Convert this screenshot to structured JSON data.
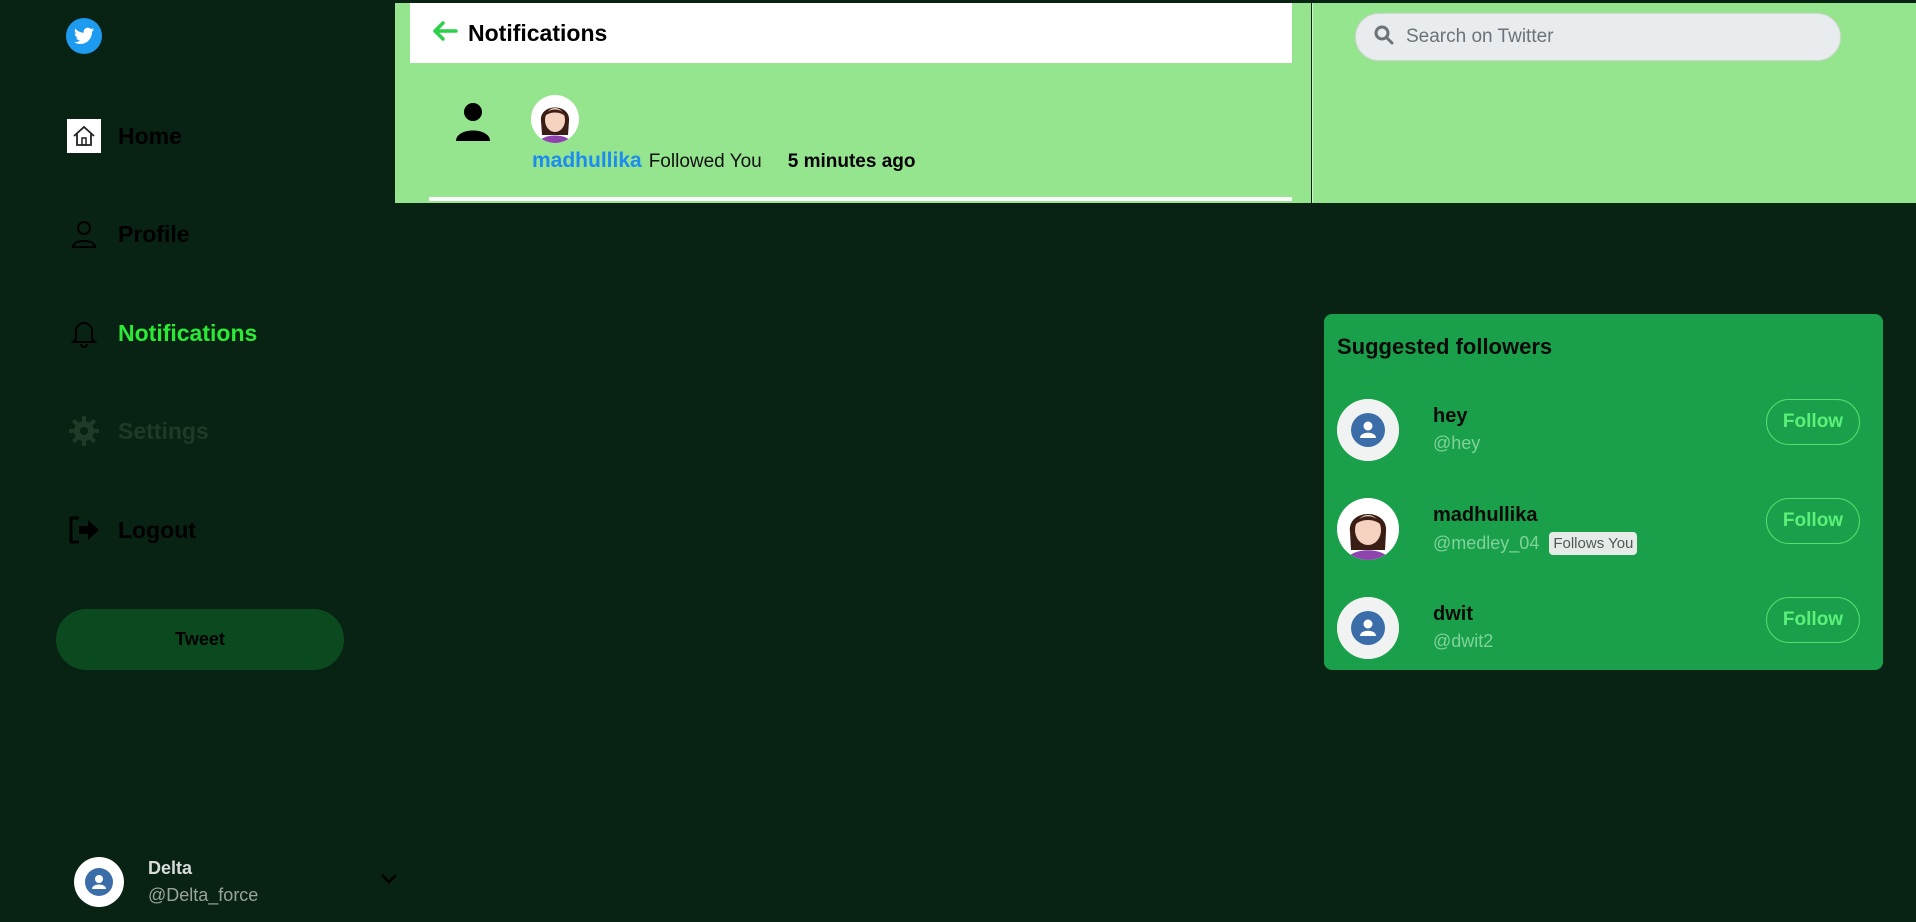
{
  "sidebar": {
    "logo_icon": "twitter-bird-icon",
    "items": [
      {
        "label": "Home",
        "icon": "home-icon"
      },
      {
        "label": "Profile",
        "icon": "user-icon"
      },
      {
        "label": "Notifications",
        "icon": "bell-icon"
      },
      {
        "label": "Settings",
        "icon": "gear-icon"
      },
      {
        "label": "Logout",
        "icon": "logout-icon"
      }
    ],
    "tweet_label": "Tweet",
    "account": {
      "name": "Delta",
      "handle": "@Delta_force"
    }
  },
  "main": {
    "header_title": "Notifications",
    "notification": {
      "user": "madhullika",
      "action": "Followed You",
      "time": "5 minutes ago"
    }
  },
  "search": {
    "placeholder": "Search on Twitter"
  },
  "suggested": {
    "title": "Suggested followers",
    "users": [
      {
        "name": "hey",
        "handle": "@hey",
        "follow_label": "Follow"
      },
      {
        "name": "madhullika",
        "handle": "@medley_04",
        "badge": "Follows You",
        "follow_label": "Follow"
      },
      {
        "name": "dwit",
        "handle": "@dwit2",
        "follow_label": "Follow"
      }
    ]
  },
  "colors": {
    "background": "#082314",
    "active_nav": "#2bea36",
    "panel_green": "#95e58f",
    "suggest_green": "#1aa04a",
    "link_blue": "#1d8bf0"
  }
}
